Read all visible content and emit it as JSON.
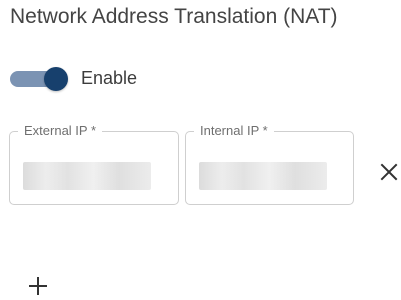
{
  "section": {
    "title": "Network Address Translation (NAT)"
  },
  "toggle": {
    "label": "Enable",
    "state": "on",
    "track_color": "#7b93b3",
    "thumb_color": "#17406d"
  },
  "fields": {
    "external_ip": {
      "label": "External IP *",
      "value_visible": false
    },
    "internal_ip": {
      "label": "Internal IP *",
      "value_visible": false
    }
  },
  "actions": {
    "remove_icon": "close-icon",
    "add_icon": "plus-icon"
  }
}
